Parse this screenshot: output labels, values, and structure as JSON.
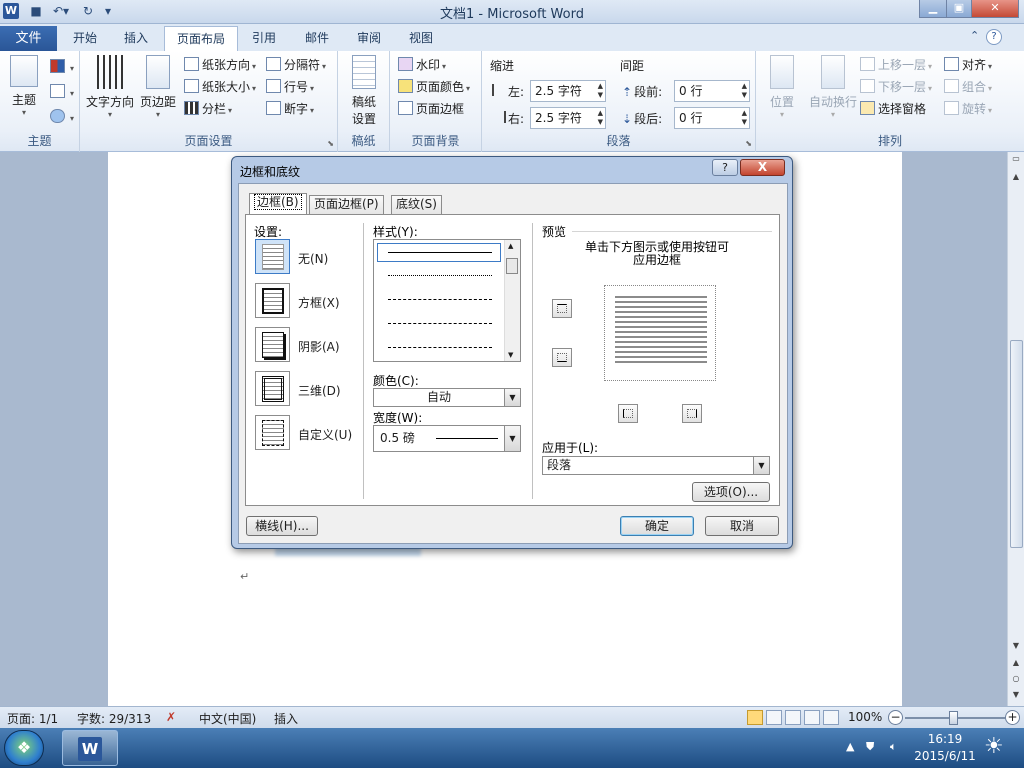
{
  "window": {
    "title": "文档1 - Microsoft Word",
    "app_icon": "W"
  },
  "tabs": {
    "file": "文件",
    "items": [
      "开始",
      "插入",
      "页面布局",
      "引用",
      "邮件",
      "审阅",
      "视图"
    ],
    "active": "页面布局"
  },
  "ribbon": {
    "theme_group": {
      "label": "主题",
      "theme_button": "主题"
    },
    "page_setup": {
      "label": "页面设置",
      "text_direction": "文字方向",
      "margins": "页边距",
      "orientation": "纸张方向",
      "size": "纸张大小",
      "columns": "分栏",
      "breaks": "分隔符",
      "line_numbers": "行号",
      "hyphenation": "断字"
    },
    "manuscript": {
      "label": "稿纸",
      "setting": "稿纸\n设置",
      "setting_line1": "稿纸",
      "setting_line2": "设置"
    },
    "page_background": {
      "label": "页面背景",
      "watermark": "水印",
      "page_color": "页面颜色",
      "page_borders": "页面边框"
    },
    "paragraph": {
      "label": "段落",
      "indent_title": "缩进",
      "indent_left_label": "左:",
      "indent_left_value": "2.5 字符",
      "indent_right_label": "右:",
      "indent_right_value": "2.5 字符",
      "spacing_title": "间距",
      "before_label": "段前:",
      "before_value": "0 行",
      "after_label": "段后:",
      "after_value": "0 行"
    },
    "arrange": {
      "label": "排列",
      "position": "位置",
      "wrap_text": "自动换行",
      "bring_forward": "上移一层",
      "send_backward": "下移一层",
      "selection_pane": "选择窗格",
      "align": "对齐",
      "group": "组合",
      "rotate": "旋转"
    }
  },
  "dialog": {
    "title": "边框和底纹",
    "help": "?",
    "close": "X",
    "tabs": [
      "边框(B)",
      "页面边框(P)",
      "底纹(S)"
    ],
    "settings_title": "设置:",
    "settings": [
      "无(N)",
      "方框(X)",
      "阴影(A)",
      "三维(D)",
      "自定义(U)"
    ],
    "style_title": "样式(Y):",
    "color_title": "颜色(C):",
    "color_value": "自动",
    "width_title": "宽度(W):",
    "width_value": "0.5 磅",
    "preview_title": "预览",
    "preview_hint_line1": "单击下方图示或使用按钮可",
    "preview_hint_line2": "应用边框",
    "apply_to_title": "应用于(L):",
    "apply_to_value": "段落",
    "options_button": "选项(O)...",
    "horizontal_line_button": "横线(H)...",
    "ok_button": "确定",
    "cancel_button": "取消"
  },
  "statusbar": {
    "page": "页面: 1/1",
    "words": "字数: 29/313",
    "language": "中文(中国)",
    "mode": "插入",
    "zoom": "100%"
  },
  "taskbar": {
    "time": "16:19",
    "date": "2015/6/11"
  }
}
